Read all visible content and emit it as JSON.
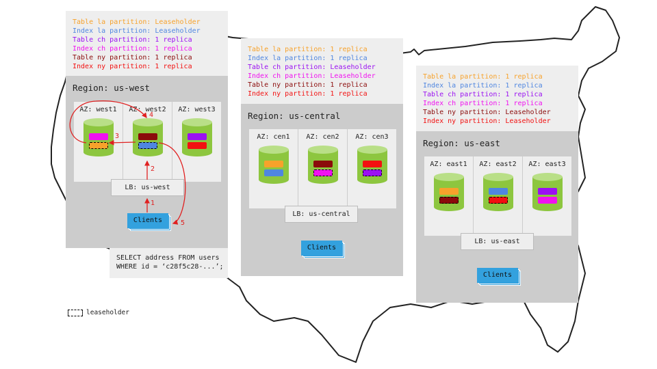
{
  "colors": {
    "table_la": "#f7a22b",
    "index_la": "#4f86e0",
    "table_ch": "#9b11f2",
    "index_ch": "#f011f0",
    "table_ny": "#8b0b0b",
    "index_ny": "#f21010",
    "cylinder": "#8dc63f",
    "clients": "#33a1de",
    "arrow": "#e02020"
  },
  "regions": [
    {
      "title": "Region: us-west",
      "legend": [
        {
          "text": "Table la partition: Leaseholder",
          "color": "#f7a22b"
        },
        {
          "text": "Index la partition: Leaseholder",
          "color": "#4f86e0"
        },
        {
          "text": "Table ch partition: 1 replica",
          "color": "#9b11f2"
        },
        {
          "text": "Index ch partition: 1 replica",
          "color": "#f011f0"
        },
        {
          "text": "Table ny partition: 1 replica",
          "color": "#8b0b0b"
        },
        {
          "text": "Index ny partition: 1 replica",
          "color": "#f21010"
        }
      ],
      "azs": [
        {
          "label": "AZ: west1",
          "replicas": [
            {
              "color": "#f011f0",
              "leaseholder": false
            },
            {
              "color": "#f7a22b",
              "leaseholder": true
            }
          ]
        },
        {
          "label": "AZ: west2",
          "replicas": [
            {
              "color": "#8b0b0b",
              "leaseholder": false
            },
            {
              "color": "#4f86e0",
              "leaseholder": true
            }
          ]
        },
        {
          "label": "AZ: west3",
          "replicas": [
            {
              "color": "#9b11f2",
              "leaseholder": false
            },
            {
              "color": "#f21010",
              "leaseholder": false
            }
          ]
        }
      ],
      "lb": "LB: us-west",
      "clients": "Clients"
    },
    {
      "title": "Region: us-central",
      "legend": [
        {
          "text": "Table la partition: 1 replica",
          "color": "#f7a22b"
        },
        {
          "text": "Index la partition: 1 replica",
          "color": "#4f86e0"
        },
        {
          "text": "Table ch partition: Leaseholder",
          "color": "#9b11f2"
        },
        {
          "text": "Index ch partition: Leaseholder",
          "color": "#f011f0"
        },
        {
          "text": "Table ny partition: 1 replica",
          "color": "#8b0b0b"
        },
        {
          "text": "Index ny partition: 1 replica",
          "color": "#f21010"
        }
      ],
      "azs": [
        {
          "label": "AZ: cen1",
          "replicas": [
            {
              "color": "#f7a22b",
              "leaseholder": false
            },
            {
              "color": "#4f86e0",
              "leaseholder": false
            }
          ]
        },
        {
          "label": "AZ: cen2",
          "replicas": [
            {
              "color": "#8b0b0b",
              "leaseholder": false
            },
            {
              "color": "#f011f0",
              "leaseholder": true
            }
          ]
        },
        {
          "label": "AZ: cen3",
          "replicas": [
            {
              "color": "#f21010",
              "leaseholder": false
            },
            {
              "color": "#9b11f2",
              "leaseholder": true
            }
          ]
        }
      ],
      "lb": "LB: us-central",
      "clients": "Clients"
    },
    {
      "title": "Region: us-east",
      "legend": [
        {
          "text": "Table la partition: 1 replica",
          "color": "#f7a22b"
        },
        {
          "text": "Index la partition: 1 replica",
          "color": "#4f86e0"
        },
        {
          "text": "Table ch partition: 1 replica",
          "color": "#9b11f2"
        },
        {
          "text": "Index ch partition: 1 replica",
          "color": "#f011f0"
        },
        {
          "text": "Table ny partition: Leaseholder",
          "color": "#8b0b0b"
        },
        {
          "text": "Index ny partition: Leaseholder",
          "color": "#f21010"
        }
      ],
      "azs": [
        {
          "label": "AZ: east1",
          "replicas": [
            {
              "color": "#f7a22b",
              "leaseholder": false
            },
            {
              "color": "#8b0b0b",
              "leaseholder": true
            }
          ]
        },
        {
          "label": "AZ: east2",
          "replicas": [
            {
              "color": "#4f86e0",
              "leaseholder": false
            },
            {
              "color": "#f21010",
              "leaseholder": true
            }
          ]
        },
        {
          "label": "AZ: east3",
          "replicas": [
            {
              "color": "#9b11f2",
              "leaseholder": false
            },
            {
              "color": "#f011f0",
              "leaseholder": false
            }
          ]
        }
      ],
      "lb": "LB: us-east",
      "clients": "Clients"
    }
  ],
  "query": "SELECT address FROM users\nWHERE id = ‘c28f5c28-...’;",
  "steps": [
    "1",
    "2",
    "3",
    "4",
    "5"
  ],
  "key_label": "leaseholder"
}
